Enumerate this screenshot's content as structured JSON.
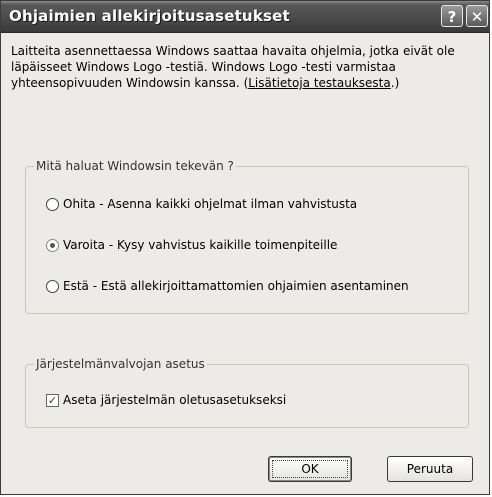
{
  "window": {
    "title": "Ohjaimien allekirjoitusasetukset",
    "help_label": "?",
    "close_label": "✕"
  },
  "intro": {
    "text": "Laitteita asennettaessa Windows saattaa havaita ohjelmia, jotka eivät ole läpäisseet Windows Logo -testiä. Windows Logo -testi varmistaa yhteensopivuuden Windowsin kanssa. (",
    "link": "Lisätietoja testauksesta",
    "suffix": ".)"
  },
  "behavior_group": {
    "legend": "Mitä haluat Windowsin tekevän ?",
    "options": [
      {
        "label": "Ohita - Asenna kaikki ohjelmat ilman vahvistusta",
        "checked": false
      },
      {
        "label": "Varoita - Kysy vahvistus kaikille toimenpiteille",
        "checked": true
      },
      {
        "label": "Estä - Estä allekirjoittamattomien ohjaimien asentaminen",
        "checked": false
      }
    ]
  },
  "admin_group": {
    "legend": "Järjestelmänvalvojan asetus",
    "checkbox_label": "Aseta järjestelmän oletusasetukseksi",
    "checked": true
  },
  "buttons": {
    "ok": "OK",
    "cancel": "Peruuta"
  }
}
